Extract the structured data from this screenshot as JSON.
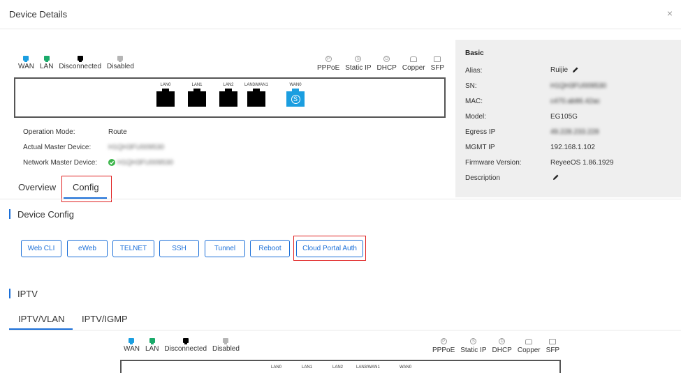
{
  "dialog": {
    "title": "Device Details",
    "close": "×"
  },
  "legend": {
    "wan": "WAN",
    "lan": "LAN",
    "disconnected": "Disconnected",
    "disabled": "Disabled",
    "pppoe": "PPPoE",
    "static_ip": "Static IP",
    "dhcp": "DHCP",
    "copper": "Copper",
    "sfp": "SFP",
    "pppoe_symbol": "P",
    "static_symbol": "S",
    "dhcp_symbol": "D"
  },
  "ports": [
    {
      "label": "LAN0",
      "state": "disconnected"
    },
    {
      "label": "LAN1",
      "state": "disconnected"
    },
    {
      "label": "LAN2",
      "state": "disconnected"
    },
    {
      "label": "LAN3/WAN1",
      "state": "disconnected"
    },
    {
      "label": "WAN0",
      "state": "wan",
      "symbol": "S"
    }
  ],
  "device_info": {
    "operation_mode_label": "Operation Mode:",
    "operation_mode_value": "Route",
    "actual_master_label": "Actual Master Device:",
    "actual_master_value": "H1QH3FU009530",
    "network_master_label": "Network Master Device:",
    "network_master_value": "H1QH3FU009530"
  },
  "basic": {
    "title": "Basic",
    "alias_label": "Alias:",
    "alias_value": "Ruijie",
    "sn_label": "SN:",
    "sn_value": "H1QH3FU009530",
    "mac_label": "MAC:",
    "mac_value": "c470.ab86.42ac",
    "model_label": "Model:",
    "model_value": "EG105G",
    "egress_ip_label": "Egress IP",
    "egress_ip_value": "49.228.233.228",
    "mgmt_ip_label": "MGMT IP",
    "mgmt_ip_value": "192.168.1.102",
    "firmware_label": "Firmware Version:",
    "firmware_value": "ReyeeOS 1.86.1929",
    "description_label": "Description"
  },
  "tabs": {
    "overview": "Overview",
    "config": "Config",
    "active": "config"
  },
  "device_config": {
    "title": "Device Config",
    "buttons": [
      "Web CLI",
      "eWeb",
      "TELNET",
      "SSH",
      "Tunnel",
      "Reboot",
      "Cloud Portal Auth"
    ]
  },
  "iptv": {
    "title": "IPTV",
    "tabs": [
      "IPTV/VLAN",
      "IPTV/IGMP"
    ],
    "active_tab": "IPTV/VLAN"
  },
  "colors": {
    "accent": "#1b6fd8",
    "wan": "#1b9ee0",
    "lan": "#1aaa6a",
    "disconnected": "#000000",
    "disabled": "#b5b5b5",
    "highlight": "#e02020",
    "online": "#3bb54a"
  }
}
